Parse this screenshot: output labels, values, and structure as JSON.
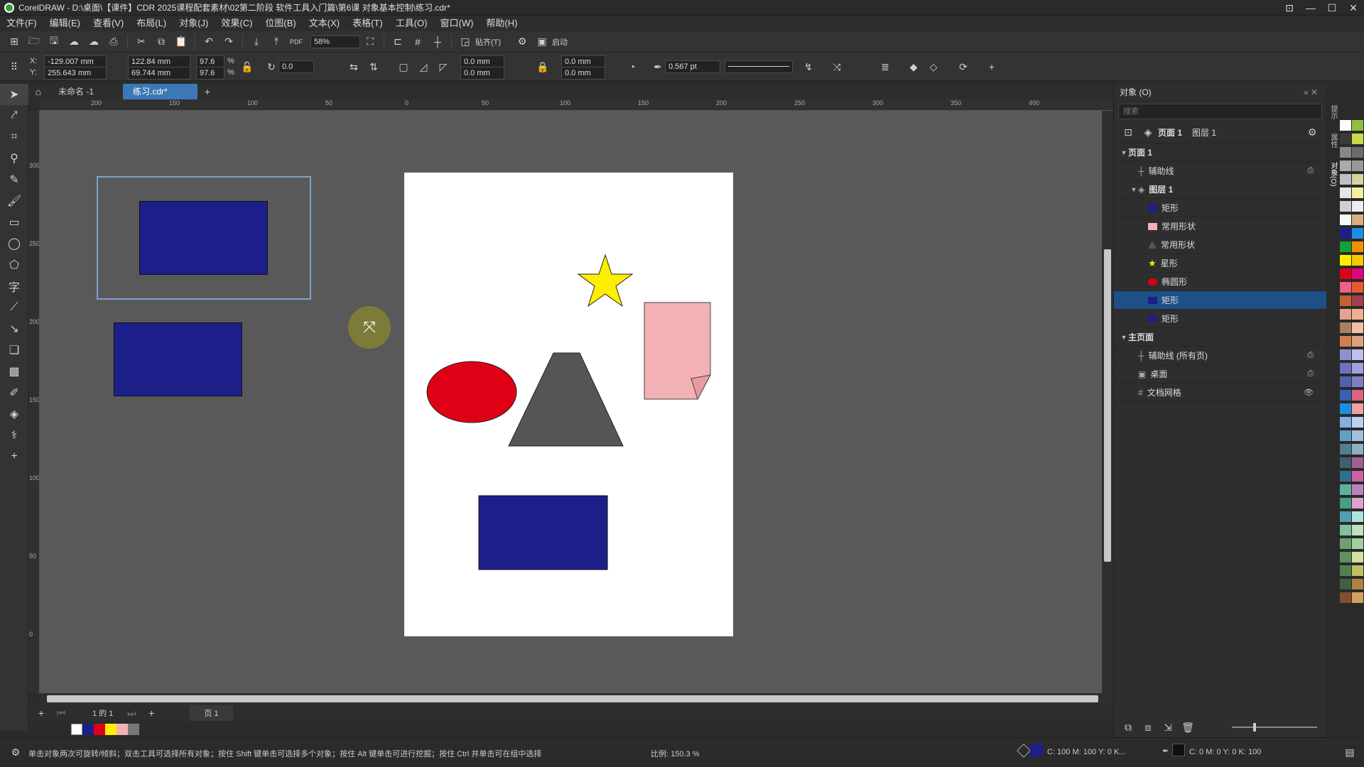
{
  "app": {
    "title": "CorelDRAW - D:\\桌面\\【课件】CDR 2025课程配套素材\\02第二阶段 软件工具入门篇\\第6课 对象基本控制\\练习.cdr*"
  },
  "menu": [
    "文件(F)",
    "编辑(E)",
    "查看(V)",
    "布局(L)",
    "对象(J)",
    "效果(C)",
    "位图(B)",
    "文本(X)",
    "表格(T)",
    "工具(O)",
    "窗口(W)",
    "帮助(H)"
  ],
  "standard_toolbar": {
    "zoom": "58%",
    "snap_label": "贴齐(T)",
    "launch_label": "启动"
  },
  "property_bar": {
    "x_label": "X:",
    "x": "-129.007 mm",
    "y_label": "Y:",
    "y": "255.643 mm",
    "w": "122.84 mm",
    "h": "69.744 mm",
    "sx": "97.6",
    "sy": "97.6",
    "pct": "%",
    "angle": "0.0",
    "corner1": "0.0 mm",
    "corner2": "0.0 mm",
    "corner3": "0.0 mm",
    "corner4": "0.0 mm",
    "outline": "0.567 pt"
  },
  "tabs": [
    {
      "label": "未命名 -1",
      "active": false
    },
    {
      "label": "练习.cdr*",
      "active": true
    }
  ],
  "ruler_h": [
    "200",
    "150",
    "100",
    "50",
    "0",
    "50",
    "100",
    "150",
    "200",
    "250",
    "300",
    "350",
    "400"
  ],
  "ruler_v": [
    "300",
    "250",
    "200",
    "150",
    "100",
    "50",
    "0"
  ],
  "page_nav": {
    "count": "1 的 1",
    "page": "页 1"
  },
  "docker": {
    "title": "对象 (O)",
    "search_placeholder": "搜索",
    "page_label": "页面 1",
    "layer_label": "图层 1",
    "rows": [
      {
        "label": "页面 1",
        "indent": 0,
        "kind": "page"
      },
      {
        "label": "辅助线",
        "indent": 1,
        "kind": "guides"
      },
      {
        "label": "图层 1",
        "indent": 1,
        "kind": "layer"
      },
      {
        "label": "矩形",
        "indent": 2,
        "kind": "rect",
        "color": "#1c1f8a"
      },
      {
        "label": "常用形状",
        "indent": 2,
        "kind": "rect",
        "color": "#f2b1b4"
      },
      {
        "label": "常用形状",
        "indent": 2,
        "kind": "tri",
        "color": "#555555"
      },
      {
        "label": "星形",
        "indent": 2,
        "kind": "star",
        "color": "#ffee00"
      },
      {
        "label": "椭圆形",
        "indent": 2,
        "kind": "ellipse",
        "color": "#e00016"
      },
      {
        "label": "矩形",
        "indent": 2,
        "kind": "rect",
        "color": "#1c1f8a",
        "selected": true
      },
      {
        "label": "矩形",
        "indent": 2,
        "kind": "rect",
        "color": "#1c1f8a"
      },
      {
        "label": "主页面",
        "indent": 0,
        "kind": "page"
      },
      {
        "label": "辅助线 (所有页)",
        "indent": 1,
        "kind": "guides"
      },
      {
        "label": "桌面",
        "indent": 1,
        "kind": "desktop"
      },
      {
        "label": "文档网格",
        "indent": 1,
        "kind": "grid"
      }
    ]
  },
  "vtabs": [
    "提示",
    "属性",
    "对象(O)"
  ],
  "status": {
    "hint": "单击对象两次可旋转/倾斜；双击工具可选择所有对象；按住 Shift 键单击可选择多个对象；按住 Alt 键单击可进行挖掘；按住 Ctrl 并单击可在组中选择",
    "scale": "比例: 150.3 %",
    "fill": "C: 100 M: 100 Y: 0 K...",
    "outline": "C: 0 M: 0 Y: 0 K: 100"
  },
  "colors": {
    "navy": "#1c1f8a",
    "red": "#e00016",
    "pink": "#f2b1b4",
    "gray_shape": "#555555",
    "yellow": "#ffee00",
    "selection": "#3c78b5"
  }
}
